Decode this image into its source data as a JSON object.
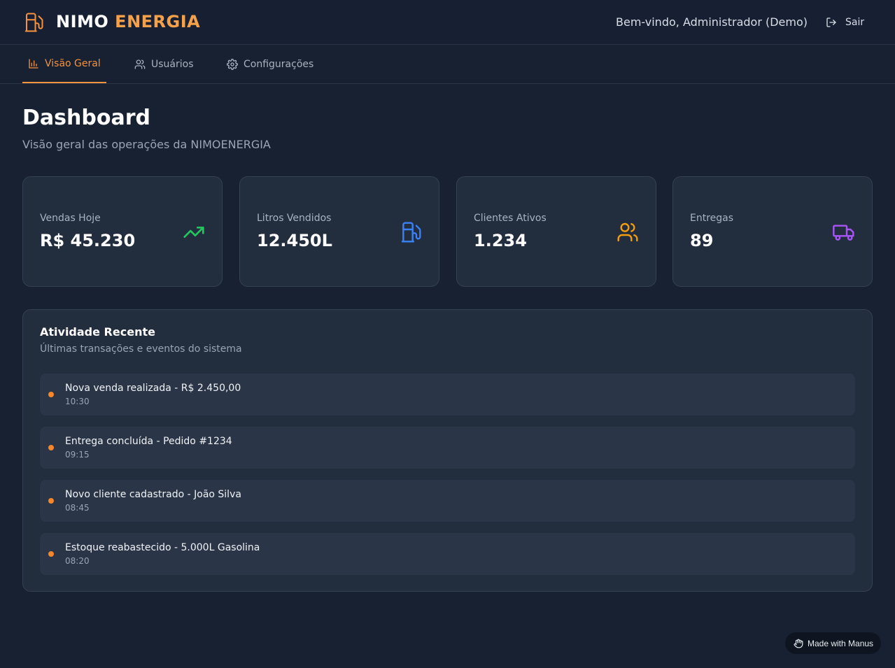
{
  "header": {
    "brand_part1": "NIMO",
    "brand_part2": "ENERGIA",
    "welcome": "Bem-vindo, Administrador (Demo)",
    "logout_label": "Sair"
  },
  "nav": {
    "tabs": [
      {
        "label": "Visão Geral",
        "icon": "bar-chart-icon",
        "active": true
      },
      {
        "label": "Usuários",
        "icon": "users-icon",
        "active": false
      },
      {
        "label": "Configurações",
        "icon": "gear-icon",
        "active": false
      }
    ]
  },
  "page": {
    "title": "Dashboard",
    "subtitle": "Visão geral das operações da NIMOENERGIA"
  },
  "stats": [
    {
      "label": "Vendas Hoje",
      "value": "R$ 45.230",
      "icon": "trending-up-icon",
      "color": "#22c55e"
    },
    {
      "label": "Litros Vendidos",
      "value": "12.450L",
      "icon": "fuel-icon",
      "color": "#3b82f6"
    },
    {
      "label": "Clientes Ativos",
      "value": "1.234",
      "icon": "users-icon",
      "color": "#f59e0b"
    },
    {
      "label": "Entregas",
      "value": "89",
      "icon": "truck-icon",
      "color": "#a855f7"
    }
  ],
  "activity": {
    "title": "Atividade Recente",
    "subtitle": "Últimas transações e eventos do sistema",
    "items": [
      {
        "text": "Nova venda realizada - R$ 2.450,00",
        "time": "10:30"
      },
      {
        "text": "Entrega concluída - Pedido #1234",
        "time": "09:15"
      },
      {
        "text": "Novo cliente cadastrado - João Silva",
        "time": "08:45"
      },
      {
        "text": "Estoque reabastecido - 5.000L Gasolina",
        "time": "08:20"
      }
    ]
  },
  "badge": {
    "label": "Made with Manus",
    "icon": "manus-icon"
  },
  "colors": {
    "accent": "#f5923e",
    "background": "#182131",
    "card": "#222d3d"
  }
}
